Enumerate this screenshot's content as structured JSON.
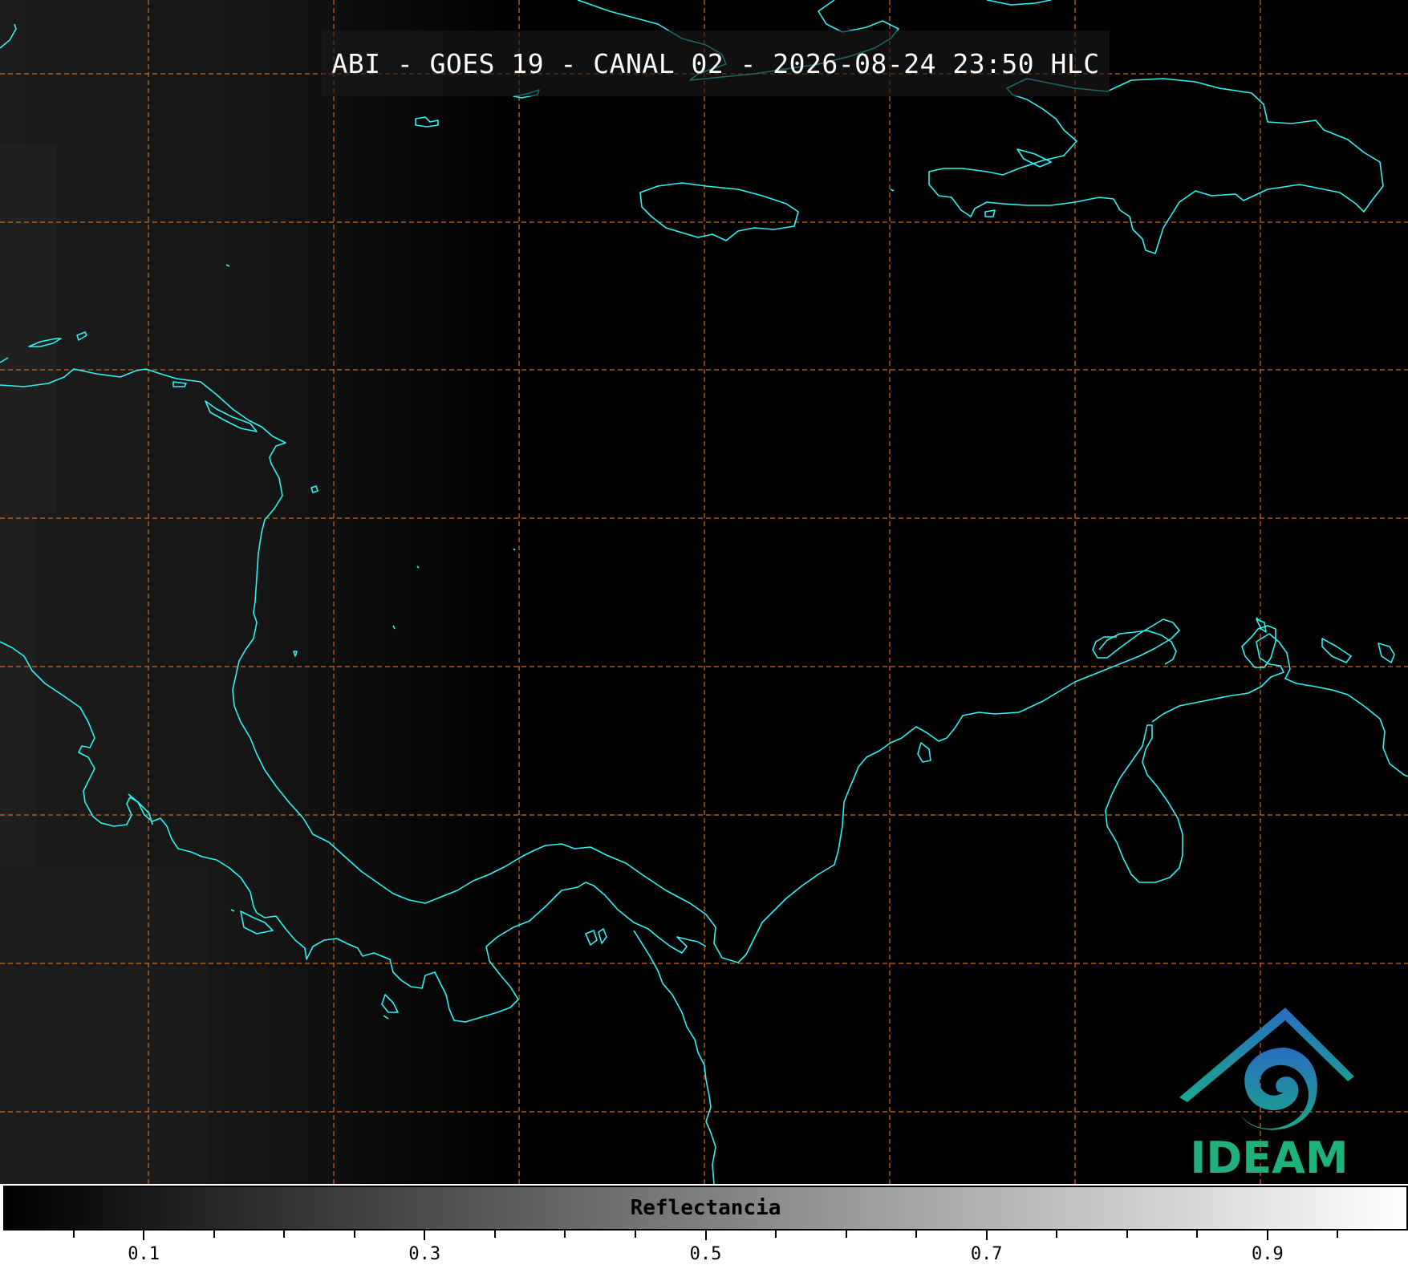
{
  "title": "ABI - GOES 19 - CANAL 02 - 2026-08-24 23:50 HLC",
  "colorbar": {
    "label": "Reflectancia",
    "range": [
      0.0,
      1.0
    ],
    "major_ticks": [
      "0.1",
      "0.3",
      "0.5",
      "0.7",
      "0.9"
    ],
    "minor_step": 0.05,
    "colormap": "grayscale (black to white)"
  },
  "logo": {
    "text": "IDEAM",
    "text_color": "#1fb07c",
    "gradient": [
      "#2a6cc0",
      "#1aa88a"
    ]
  },
  "colors": {
    "coastline": "#2ef2f2",
    "grid": "#d2691e",
    "background": "#000000"
  },
  "map": {
    "grid_style": "dashed",
    "layers": [
      "coastlines",
      "lat/lon grid"
    ]
  }
}
